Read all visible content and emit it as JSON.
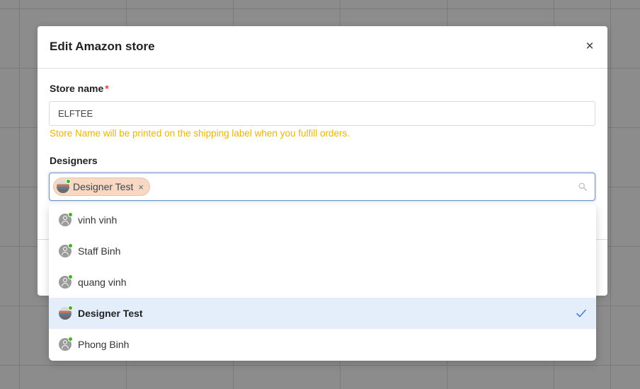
{
  "modal": {
    "title": "Edit Amazon store",
    "close_glyph": "×"
  },
  "store_name": {
    "label": "Store name",
    "required_mark": "*",
    "value": "ELFTEE",
    "help_text": "Store Name will be printed on the shipping label when you fulfill orders."
  },
  "designers": {
    "label": "Designers",
    "selected_tags": [
      {
        "label": "Designer Test",
        "remove_glyph": "×",
        "avatar": "photo-avatar"
      }
    ],
    "search_icon": "search-icon"
  },
  "dropdown": {
    "options": [
      {
        "label": "vinh vinh",
        "avatar": "user-avatar-icon",
        "online": true,
        "selected": false
      },
      {
        "label": "Staff Binh",
        "avatar": "user-avatar-icon",
        "online": true,
        "selected": false
      },
      {
        "label": "quang vinh",
        "avatar": "user-avatar-icon",
        "online": true,
        "selected": false
      },
      {
        "label": "Designer Test",
        "avatar": "photo-avatar",
        "online": true,
        "selected": true
      },
      {
        "label": "Phong Binh",
        "avatar": "user-avatar-icon",
        "online": true,
        "selected": false
      }
    ],
    "check_icon": "check-icon"
  },
  "colors": {
    "accent": "#6f8fc4",
    "selected_row": "#e3eefa",
    "warning_text": "#e8b500",
    "required": "#e04343",
    "online": "#3db512",
    "tag_bg": "#f7d8c4"
  }
}
